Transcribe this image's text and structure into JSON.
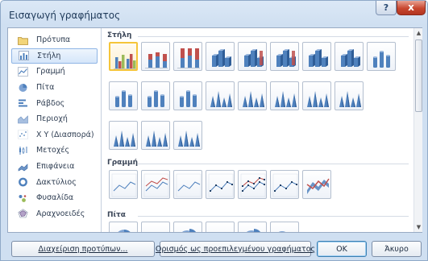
{
  "window": {
    "title": "Εισαγωγή γραφήματος",
    "help_label": "?",
    "close_label": "x"
  },
  "sidebar": {
    "items": [
      {
        "label": "Πρότυπα",
        "icon": "folder-icon"
      },
      {
        "label": "Στήλη",
        "icon": "column-chart-icon",
        "selected": true
      },
      {
        "label": "Γραμμή",
        "icon": "line-chart-icon"
      },
      {
        "label": "Πίτα",
        "icon": "pie-chart-icon"
      },
      {
        "label": "Ράβδος",
        "icon": "bar-chart-icon"
      },
      {
        "label": "Περιοχή",
        "icon": "area-chart-icon"
      },
      {
        "label": "X Y (Διασπορά)",
        "icon": "scatter-chart-icon"
      },
      {
        "label": "Μετοχές",
        "icon": "stock-chart-icon"
      },
      {
        "label": "Επιφάνεια",
        "icon": "surface-chart-icon"
      },
      {
        "label": "Δακτύλιος",
        "icon": "doughnut-chart-icon"
      },
      {
        "label": "Φυσαλίδα",
        "icon": "bubble-chart-icon"
      },
      {
        "label": "Αραχνοειδές",
        "icon": "radar-chart-icon"
      }
    ]
  },
  "sections": {
    "column": "Στήλη",
    "line": "Γραμμή",
    "pie": "Πίτα"
  },
  "buttons": {
    "manage": "Διαχείριση προτύπων...",
    "set_default": "Ορισμός ως προεπιλεγμένου γραφήματος",
    "ok": "OK",
    "cancel": "Άκυρο"
  },
  "scrollbar": {
    "up_label": "▲",
    "down_label": "▼"
  },
  "colors": {
    "accent": "#4f81bd",
    "selection": "#f5c53a",
    "close": "#c8472f"
  }
}
